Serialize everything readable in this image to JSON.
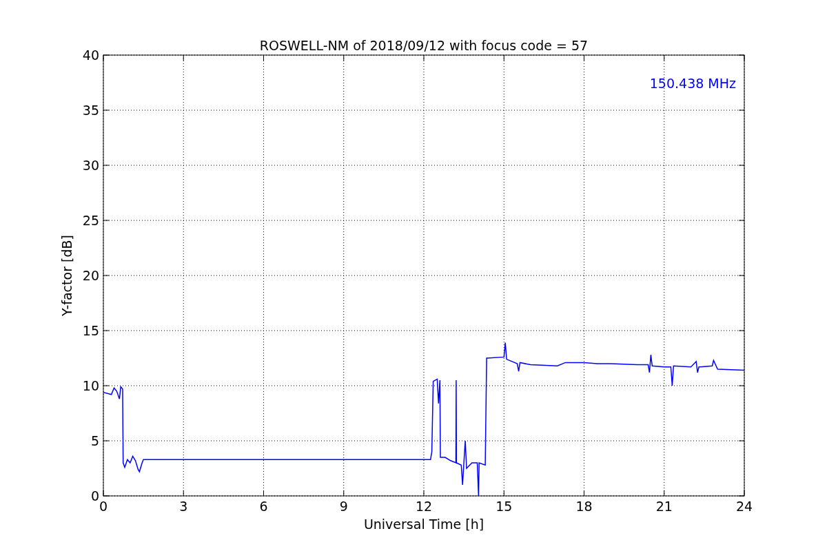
{
  "figure": {
    "chart_data": {
      "type": "line",
      "title": "ROSWELL-NM of 2018/09/12 with focus code = 57",
      "xlabel": "Universal Time [h]",
      "ylabel": "Y-factor [dB]",
      "xlim": [
        0,
        24
      ],
      "ylim": [
        0,
        40
      ],
      "xticks": [
        0,
        3,
        6,
        9,
        12,
        15,
        18,
        21,
        24
      ],
      "yticks": [
        0,
        5,
        10,
        15,
        20,
        25,
        30,
        35,
        40
      ],
      "x": [
        0,
        0.3,
        0.4,
        0.5,
        0.6,
        0.65,
        0.72,
        0.74,
        0.8,
        0.9,
        1.0,
        1.1,
        1.2,
        1.3,
        1.35,
        1.45,
        1.5,
        12.25,
        12.3,
        12.35,
        12.5,
        12.55,
        12.6,
        12.62,
        12.8,
        13.0,
        13.2,
        13.21,
        13.22,
        13.4,
        13.45,
        13.5,
        13.55,
        13.6,
        13.8,
        14.0,
        14.05,
        14.07,
        14.3,
        14.35,
        15.0,
        15.05,
        15.1,
        15.5,
        15.55,
        15.6,
        16,
        17,
        17.3,
        18,
        18.5,
        19,
        20,
        20.4,
        20.45,
        20.5,
        20.55,
        21,
        21.25,
        21.3,
        21.35,
        22,
        22.2,
        22.25,
        22.3,
        22.8,
        22.85,
        23,
        24
      ],
      "series": [
        {
          "name": "150.438 MHz",
          "color": "#0000ff",
          "values": [
            9.4,
            9.2,
            9.8,
            9.5,
            8.8,
            9.9,
            9.7,
            3.0,
            2.6,
            3.3,
            3.0,
            3.6,
            3.2,
            2.4,
            2.2,
            3.0,
            3.3,
            3.3,
            4.0,
            10.4,
            10.6,
            8.4,
            10.5,
            3.5,
            3.5,
            3.2,
            3.0,
            10.5,
            3.0,
            2.8,
            1.0,
            3.0,
            5.0,
            2.5,
            3.0,
            3.0,
            0,
            3.0,
            2.8,
            12.5,
            12.6,
            13.9,
            12.4,
            12.0,
            11.3,
            12.1,
            11.9,
            11.8,
            12.1,
            12.1,
            12.0,
            12.0,
            11.9,
            11.9,
            11.2,
            12.8,
            11.8,
            11.7,
            11.7,
            10.0,
            11.8,
            11.7,
            12.2,
            11.2,
            11.7,
            11.8,
            12.3,
            11.5,
            11.4
          ]
        }
      ],
      "grid": true
    }
  }
}
